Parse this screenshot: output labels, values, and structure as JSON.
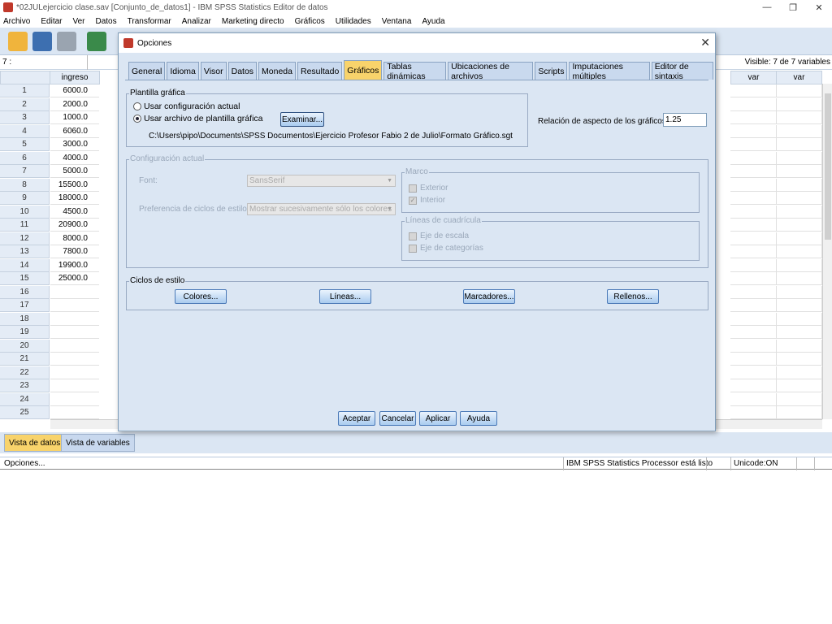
{
  "window": {
    "title": "*02JULejercicio clase.sav [Conjunto_de_datos1] - IBM SPSS Statistics Editor de datos",
    "controls": [
      "—",
      "❐",
      "✕"
    ]
  },
  "menubar": [
    "Archivo",
    "Editar",
    "Ver",
    "Datos",
    "Transformar",
    "Analizar",
    "Marketing directo",
    "Gráficos",
    "Utilidades",
    "Ventana",
    "Ayuda"
  ],
  "cell_ref": "7 :",
  "visible_vars": "Visible: 7 de 7 variables",
  "grid": {
    "column_header": "ingreso",
    "right_headers": [
      "var",
      "var"
    ],
    "rows": [
      {
        "n": "1",
        "v": "6000.0"
      },
      {
        "n": "2",
        "v": "2000.0"
      },
      {
        "n": "3",
        "v": "1000.0"
      },
      {
        "n": "4",
        "v": "6060.0"
      },
      {
        "n": "5",
        "v": "3000.0"
      },
      {
        "n": "6",
        "v": "4000.0"
      },
      {
        "n": "7",
        "v": "5000.0"
      },
      {
        "n": "8",
        "v": "15500.0"
      },
      {
        "n": "9",
        "v": "18000.0"
      },
      {
        "n": "10",
        "v": "4500.0"
      },
      {
        "n": "11",
        "v": "20900.0"
      },
      {
        "n": "12",
        "v": "8000.0"
      },
      {
        "n": "13",
        "v": "7800.0"
      },
      {
        "n": "14",
        "v": "19900.0"
      },
      {
        "n": "15",
        "v": "25000.0"
      },
      {
        "n": "16",
        "v": ""
      },
      {
        "n": "17",
        "v": ""
      },
      {
        "n": "18",
        "v": ""
      },
      {
        "n": "19",
        "v": ""
      },
      {
        "n": "20",
        "v": ""
      },
      {
        "n": "21",
        "v": ""
      },
      {
        "n": "22",
        "v": ""
      },
      {
        "n": "23",
        "v": ""
      },
      {
        "n": "24",
        "v": ""
      },
      {
        "n": "25",
        "v": ""
      }
    ]
  },
  "view_tabs": {
    "data": "Vista de datos",
    "variables": "Vista de variables"
  },
  "status": {
    "left": "Opciones...",
    "processor": "IBM SPSS Statistics Processor está listo",
    "unicode": "Unicode:ON"
  },
  "dialog": {
    "title": "Opciones",
    "close": "✕",
    "tabs": [
      "General",
      "Idioma",
      "Visor",
      "Datos",
      "Moneda",
      "Resultado",
      "Gráficos",
      "Tablas dinámicas",
      "Ubicaciones de archivos",
      "Scripts",
      "Imputaciones múltiples",
      "Editor de sintaxis"
    ],
    "active_tab": "Gráficos",
    "plantilla": {
      "label": "Plantilla gráfica",
      "option_actual": "Usar configuración actual",
      "option_archivo": "Usar archivo de plantilla gráfica",
      "browse": "Examinar...",
      "path": "C:\\Users\\pipo\\Documents\\SPSS Documentos\\Ejercicio Profesor Fabio 2 de Julio\\Formato Gráfico.sgt"
    },
    "aspect": {
      "label": "Relación de aspecto de los gráficos:",
      "value": "1.25"
    },
    "config": {
      "label": "Configuración actual",
      "font_label": "Font:",
      "font_value": "SansSerif",
      "ciclos_label": "Preferencia de ciclos de estilo:",
      "ciclos_value": "Mostrar sucesivamente sólo los colores",
      "marco": {
        "label": "Marco",
        "exterior": "Exterior",
        "interior": "Interior"
      },
      "lineas": {
        "label": "Líneas de cuadrícula",
        "escala": "Eje de escala",
        "categorias": "Eje de categorías"
      }
    },
    "ciclos": {
      "label": "Ciclos de estilo",
      "colores": "Colores...",
      "lineas": "Líneas...",
      "marcadores": "Marcadores...",
      "rellenos": "Rellenos..."
    },
    "buttons": {
      "aceptar": "Aceptar",
      "cancelar": "Cancelar",
      "aplicar": "Aplicar",
      "ayuda": "Ayuda"
    }
  }
}
